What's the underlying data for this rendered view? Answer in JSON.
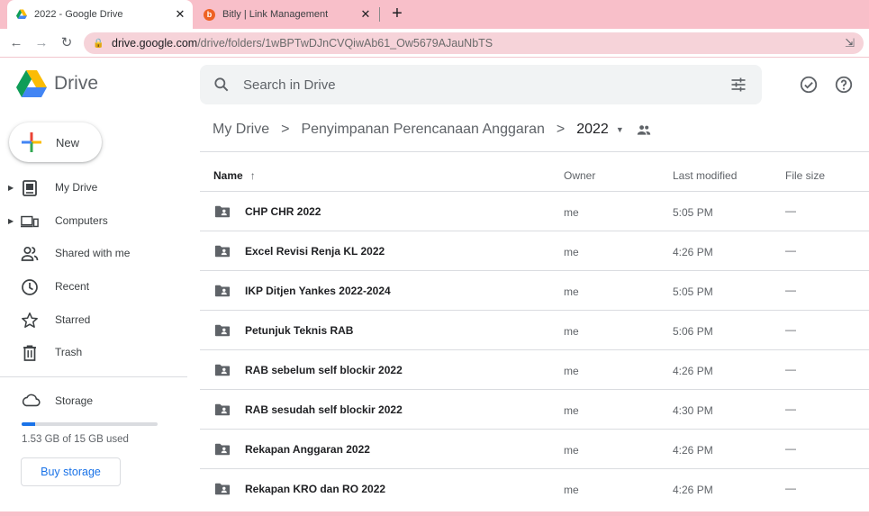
{
  "browser": {
    "tabs": [
      {
        "title": "2022 - Google Drive",
        "icon": "google-drive-icon",
        "active": true
      },
      {
        "title": "Bitly | Link Management",
        "icon": "bitly-icon",
        "active": false
      }
    ],
    "new_tab_label": "+",
    "url_domain": "drive.google.com",
    "url_path": "/drive/folders/1wBPTwDJnCVQiwAb61_Ow5679AJauNbTS",
    "colors": {
      "tabbar": "#f8bfc9",
      "omnibox": "#f6d3d9"
    }
  },
  "header": {
    "logo_text": "Drive",
    "search_placeholder": "Search in Drive"
  },
  "sidebar": {
    "new_label": "New",
    "items": [
      {
        "label": "My Drive",
        "icon": "my-drive-icon",
        "expandable": true
      },
      {
        "label": "Computers",
        "icon": "computers-icon",
        "expandable": true
      },
      {
        "label": "Shared with me",
        "icon": "shared-icon",
        "expandable": false
      },
      {
        "label": "Recent",
        "icon": "clock-icon",
        "expandable": false
      },
      {
        "label": "Starred",
        "icon": "star-icon",
        "expandable": false
      },
      {
        "label": "Trash",
        "icon": "trash-icon",
        "expandable": false
      }
    ],
    "storage": {
      "label": "Storage",
      "used_text": "1.53 GB of 15 GB used",
      "used_fraction": 0.102,
      "buy_label": "Buy storage"
    }
  },
  "breadcrumb": {
    "items": [
      "My Drive",
      "Penyimpanan Perencanaan Anggaran"
    ],
    "current": "2022",
    "separator": ">"
  },
  "table": {
    "columns": {
      "name": "Name",
      "sort_arrow": "↑",
      "owner": "Owner",
      "modified": "Last modified",
      "size": "File size"
    },
    "rows": [
      {
        "name": "CHP CHR 2022",
        "owner": "me",
        "modified": "5:05 PM",
        "size": "—"
      },
      {
        "name": "Excel Revisi Renja KL 2022",
        "owner": "me",
        "modified": "4:26 PM",
        "size": "—"
      },
      {
        "name": "IKP Ditjen Yankes 2022-2024",
        "owner": "me",
        "modified": "5:05 PM",
        "size": "—"
      },
      {
        "name": "Petunjuk Teknis RAB",
        "owner": "me",
        "modified": "5:06 PM",
        "size": "—"
      },
      {
        "name": "RAB sebelum self blockir 2022",
        "owner": "me",
        "modified": "4:26 PM",
        "size": "—"
      },
      {
        "name": "RAB sesudah self blockir 2022",
        "owner": "me",
        "modified": "4:30 PM",
        "size": "—"
      },
      {
        "name": "Rekapan Anggaran 2022",
        "owner": "me",
        "modified": "4:26 PM",
        "size": "—"
      },
      {
        "name": "Rekapan KRO dan RO 2022",
        "owner": "me",
        "modified": "4:26 PM",
        "size": "—"
      }
    ]
  }
}
